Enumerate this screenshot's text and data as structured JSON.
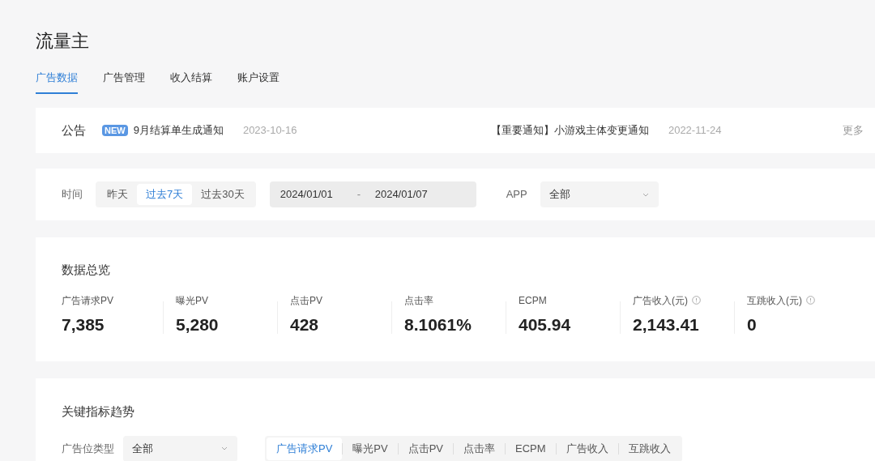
{
  "page_title": "流量主",
  "tabs": [
    {
      "label": "广告数据",
      "selected": true
    },
    {
      "label": "广告管理",
      "selected": false
    },
    {
      "label": "收入结算",
      "selected": false
    },
    {
      "label": "账户设置",
      "selected": false
    }
  ],
  "notices": {
    "label": "公告",
    "items": [
      {
        "badge": "NEW",
        "title": "9月结算单生成通知",
        "date": "2023-10-16"
      },
      {
        "title": "【重要通知】小游戏主体变更通知",
        "date": "2022-11-24"
      }
    ],
    "more": "更多"
  },
  "filters": {
    "time_label": "时间",
    "ranges": [
      {
        "label": "昨天",
        "selected": false
      },
      {
        "label": "过去7天",
        "selected": true
      },
      {
        "label": "过去30天",
        "selected": false
      }
    ],
    "date_start": "2024/01/01",
    "date_separator": "-",
    "date_end": "2024/01/07",
    "app_label": "APP",
    "app_value": "全部"
  },
  "overview": {
    "title": "数据总览",
    "metrics": [
      {
        "label": "广告请求PV",
        "value": "7,385",
        "info": false
      },
      {
        "label": "曝光PV",
        "value": "5,280",
        "info": false
      },
      {
        "label": "点击PV",
        "value": "428",
        "info": false
      },
      {
        "label": "点击率",
        "value": "8.1061%",
        "info": false
      },
      {
        "label": "ECPM",
        "value": "405.94",
        "info": false
      },
      {
        "label": "广告收入(元)",
        "value": "2,143.41",
        "info": true
      },
      {
        "label": "互跳收入(元)",
        "value": "0",
        "info": true
      }
    ]
  },
  "trends": {
    "title": "关键指标趋势",
    "slot_label": "广告位类型",
    "slot_value": "全部",
    "metric_tabs": [
      {
        "label": "广告请求PV",
        "selected": true
      },
      {
        "label": "曝光PV",
        "selected": false
      },
      {
        "label": "点击PV",
        "selected": false
      },
      {
        "label": "点击率",
        "selected": false
      },
      {
        "label": "ECPM",
        "selected": false
      },
      {
        "label": "广告收入",
        "selected": false
      },
      {
        "label": "互跳收入",
        "selected": false
      }
    ]
  }
}
